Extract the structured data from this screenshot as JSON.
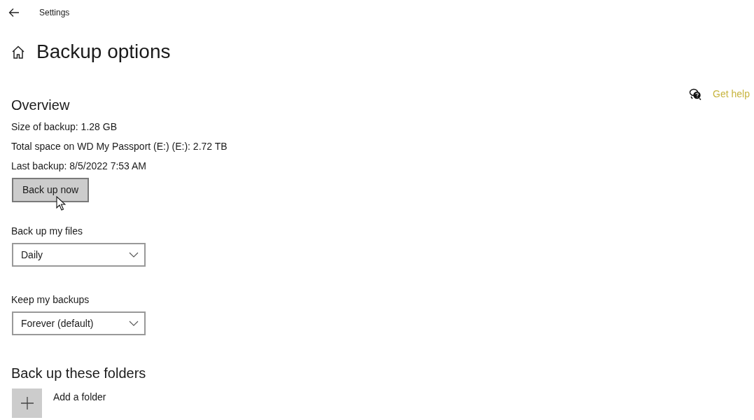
{
  "window": {
    "title": "Settings"
  },
  "page": {
    "title": "Backup options"
  },
  "help_link": {
    "label": "Get help"
  },
  "overview": {
    "heading": "Overview",
    "lines": [
      "Size of backup: 1.28 GB",
      "Total space on WD My Passport (E:) (E:): 2.72 TB",
      "Last backup: 8/5/2022 7:53 AM"
    ],
    "button": {
      "label": "Back up now",
      "hovered": true
    }
  },
  "dropdowns": [
    {
      "label": "Back up my files",
      "value": "Daily"
    },
    {
      "label": "Keep my backups",
      "value": "Forever (default)"
    }
  ],
  "folders": {
    "heading": "Back up these folders",
    "add_label": "Add a folder"
  }
}
